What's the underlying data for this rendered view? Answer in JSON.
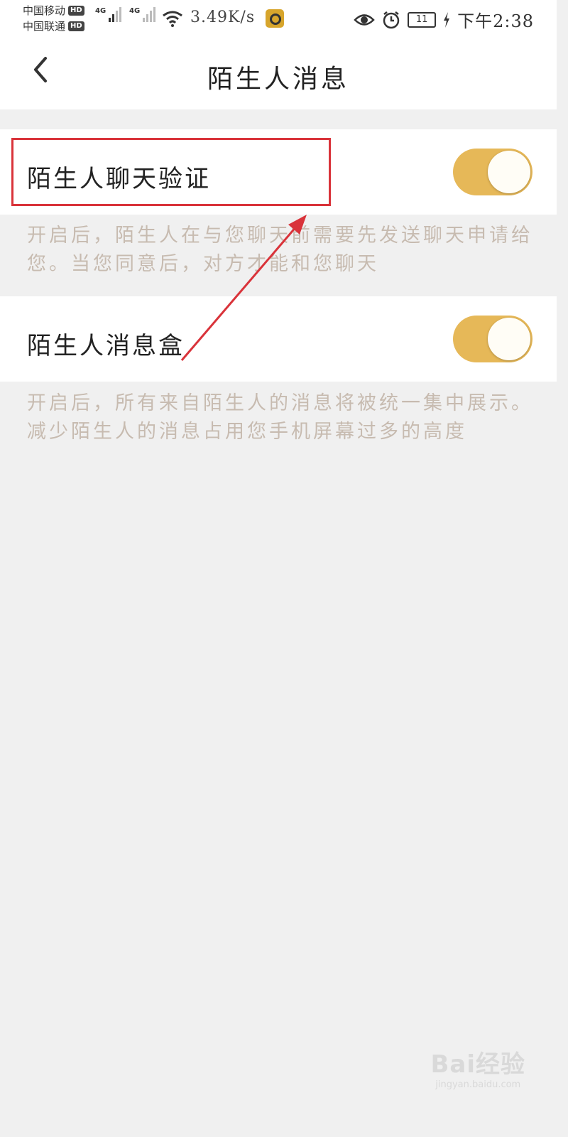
{
  "status_bar": {
    "carrier1": "中国移动",
    "carrier2": "中国联通",
    "hd": "HD",
    "network_type": "4G",
    "net_speed": "3.49K/s",
    "battery": "11",
    "time": "下午2:38",
    "icons": [
      "signal-icon",
      "wifi-icon",
      "app-notification-icon",
      "eye-icon",
      "alarm-icon",
      "battery-icon",
      "charging-icon"
    ]
  },
  "nav": {
    "title": "陌生人消息",
    "back_icon": "chevron-left-icon"
  },
  "settings": [
    {
      "label": "陌生人聊天验证",
      "enabled": true,
      "description": "开启后，陌生人在与您聊天前需要先发送聊天申请给您。当您同意后，对方才能和您聊天"
    },
    {
      "label": "陌生人消息盒",
      "enabled": true,
      "description": "开启后，所有来自陌生人的消息将被统一集中展示。减少陌生人的消息占用您手机屏幕过多的高度"
    }
  ],
  "annotation": {
    "highlight_color": "#d9333a",
    "arrow_color": "#d9333a"
  },
  "watermark": {
    "logo": "Bai经验",
    "url": "jingyan.baidu.com"
  },
  "colors": {
    "toggle_on": "#e6b858",
    "background": "#f0f0f0",
    "description_text": "#c7bbb0"
  }
}
